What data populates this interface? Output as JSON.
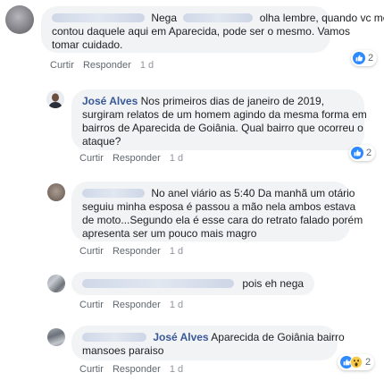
{
  "actions": {
    "like": "Curtir",
    "reply": "Responder"
  },
  "comments": [
    {
      "text_a": "Nega",
      "text_b": "olha lembre, quando vc me",
      "line2": "contou daquele aqui em Aparecida, pode ser o mesmo. Vamos",
      "line3": "tomar cuidado.",
      "time": "1 d",
      "reaction_count": "2"
    },
    {
      "author": "José Alves",
      "line1_text": "Nos primeiros dias de janeiro de 2019,",
      "line2": "surgiram relatos de um homem agindo da mesma forma em",
      "line3": "bairros de Aparecida de Goiânia. Qual bairro que ocorreu o",
      "line4": "ataque?",
      "time": "1 d",
      "reaction_count": "2"
    },
    {
      "line1_text": "No anel viário as 5:40 Da manhã um otário",
      "line2": "seguiu minha esposa é passou a mão nela ambos estava",
      "line3": "de moto...Segundo ela é esse cara do retrato falado porém",
      "line4": "apresenta ser um pouco mais magro",
      "time": "1 d"
    },
    {
      "text": "pois eh nega",
      "time": "1 d"
    },
    {
      "mention": "José Alves",
      "line1_text": "Aparecida de Goiânia bairro",
      "line2": "mansoes paraiso",
      "time": "1 d",
      "reaction_count": "2"
    }
  ]
}
